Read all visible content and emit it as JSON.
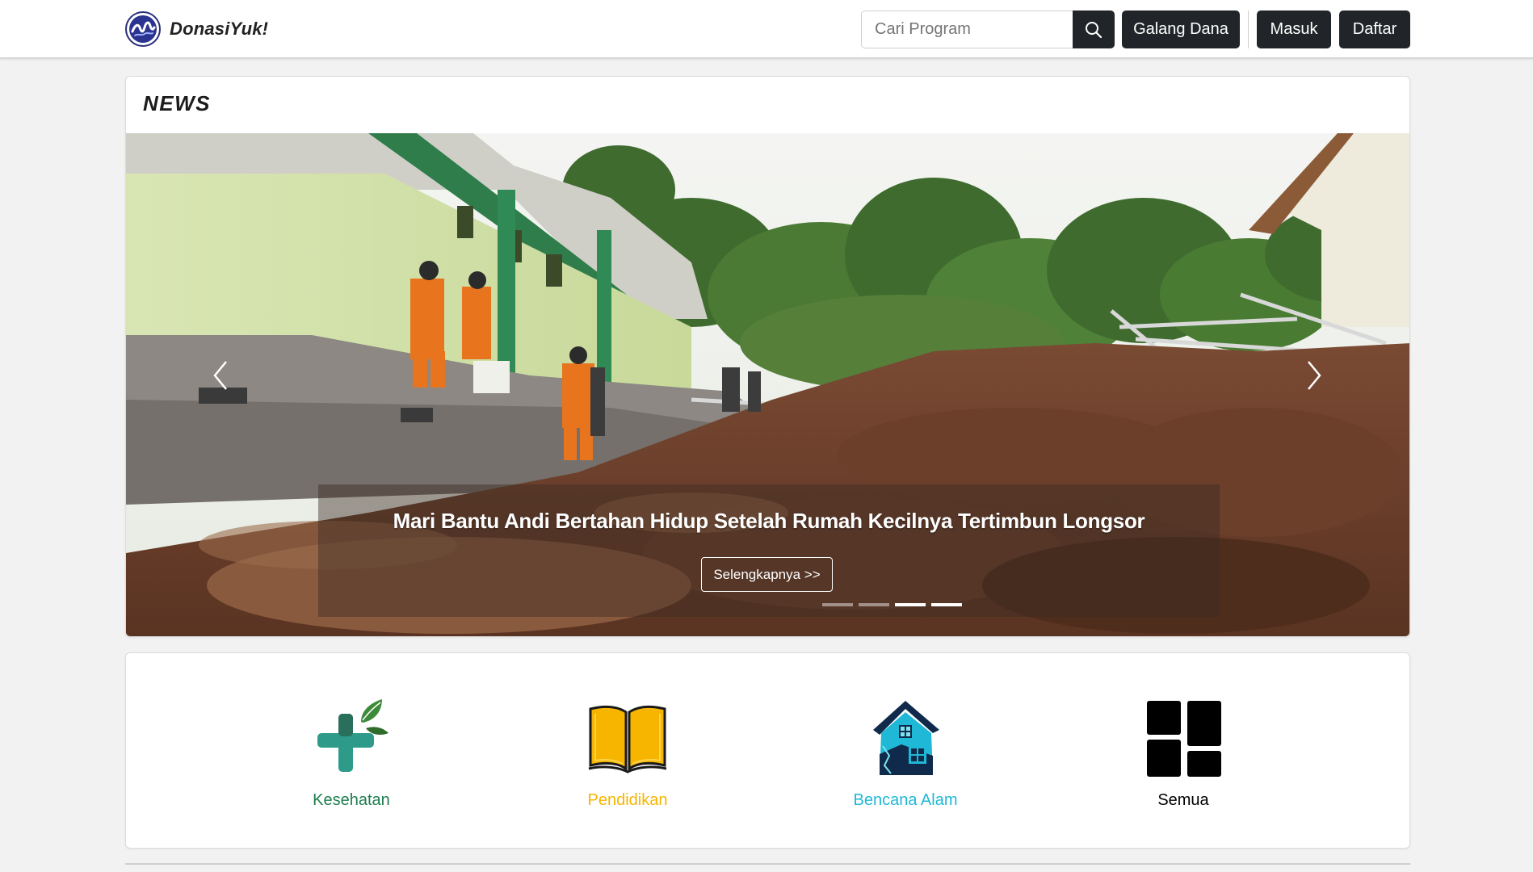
{
  "navbar": {
    "brand_name": "DonasiYuk!",
    "search_placeholder": "Cari Program",
    "galang_dana_label": "Galang Dana",
    "masuk_label": "Masuk",
    "daftar_label": "Daftar"
  },
  "news": {
    "section_title": "NEWS",
    "slide_caption": "Mari Bantu Andi Bertahan Hidup Setelah Rumah Kecilnya Tertimbun Longsor",
    "slide_button_label": "Selengkapnya >>",
    "slide_count": 4,
    "active_slide": 3
  },
  "categories": [
    {
      "label": "Kesehatan",
      "color": "#1e7d4e",
      "icon": "medical-cross-leaf-icon"
    },
    {
      "label": "Pendidikan",
      "color": "#f7b500",
      "icon": "open-book-icon"
    },
    {
      "label": "Bencana Alam",
      "color": "#1fb8d6",
      "icon": "collapsed-house-icon"
    },
    {
      "label": "Semua",
      "color": "#000000",
      "icon": "grid-icon"
    }
  ],
  "colors": {
    "navbar_bg": "#ffffff",
    "button_dark": "#212529",
    "page_bg": "#f2f2f2"
  }
}
